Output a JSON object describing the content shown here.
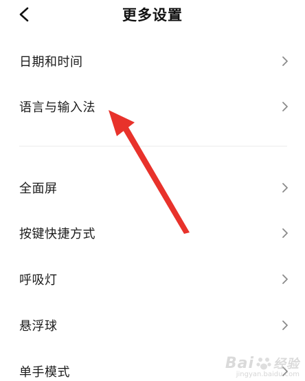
{
  "header": {
    "title": "更多设置",
    "back_icon": "chevron-left-icon"
  },
  "settings": {
    "items": [
      {
        "label": "日期和时间",
        "icon": "chevron-right-icon"
      },
      {
        "label": "语言与输入法",
        "icon": "chevron-right-icon"
      },
      {
        "label": "全面屏",
        "icon": "chevron-right-icon"
      },
      {
        "label": "按键快捷方式",
        "icon": "chevron-right-icon"
      },
      {
        "label": "呼吸灯",
        "icon": "chevron-right-icon"
      },
      {
        "label": "悬浮球",
        "icon": "chevron-right-icon"
      },
      {
        "label": "单手模式",
        "icon": "chevron-right-icon"
      }
    ]
  },
  "annotation": {
    "arrow_color": "#e8322b",
    "target": "语言与输入法"
  },
  "watermark": {
    "brand": "Bai",
    "brand_suffix": "经验",
    "url": "jingyan.baidu.com"
  },
  "colors": {
    "text": "#1c1c1c",
    "chevron": "#8a8a8a",
    "divider": "#ececec",
    "background": "#ffffff"
  }
}
